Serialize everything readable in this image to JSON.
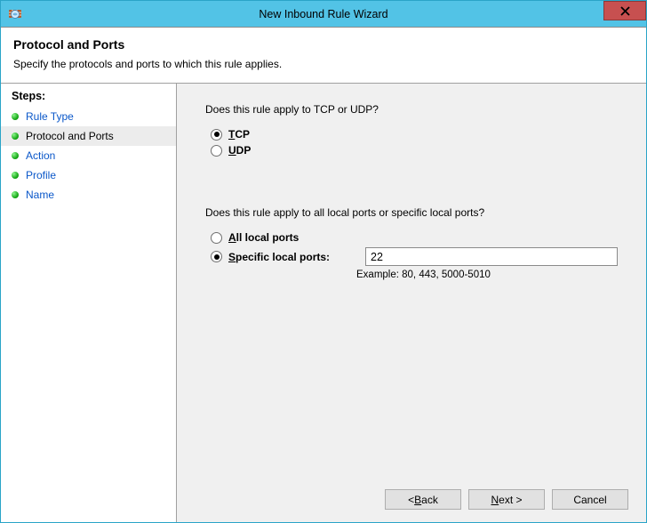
{
  "window": {
    "title": "New Inbound Rule Wizard",
    "close_tooltip": "Close"
  },
  "header": {
    "title": "Protocol and Ports",
    "subtitle": "Specify the protocols and ports to which this rule applies."
  },
  "sidebar": {
    "heading": "Steps:",
    "items": [
      {
        "label": "Rule Type",
        "current": false
      },
      {
        "label": "Protocol and Ports",
        "current": true
      },
      {
        "label": "Action",
        "current": false
      },
      {
        "label": "Profile",
        "current": false
      },
      {
        "label": "Name",
        "current": false
      }
    ]
  },
  "main": {
    "question1": "Does this rule apply to TCP or UDP?",
    "protocol": {
      "options": [
        {
          "key": "tcp",
          "label_pre": "",
          "label_u": "T",
          "label_post": "CP",
          "checked": true
        },
        {
          "key": "udp",
          "label_pre": "",
          "label_u": "U",
          "label_post": "DP",
          "checked": false
        }
      ]
    },
    "question2": "Does this rule apply to all local ports or specific local ports?",
    "ports": {
      "options": [
        {
          "key": "all",
          "label_pre": "",
          "label_u": "A",
          "label_post": "ll local ports",
          "checked": false
        },
        {
          "key": "specific",
          "label_pre": "",
          "label_u": "S",
          "label_post": "pecific local ports:",
          "checked": true
        }
      ],
      "value": "22",
      "example": "Example: 80, 443, 5000-5010"
    }
  },
  "buttons": {
    "back_pre": "< ",
    "back_u": "B",
    "back_post": "ack",
    "next_pre": "",
    "next_u": "N",
    "next_post": "ext >",
    "cancel": "Cancel"
  }
}
